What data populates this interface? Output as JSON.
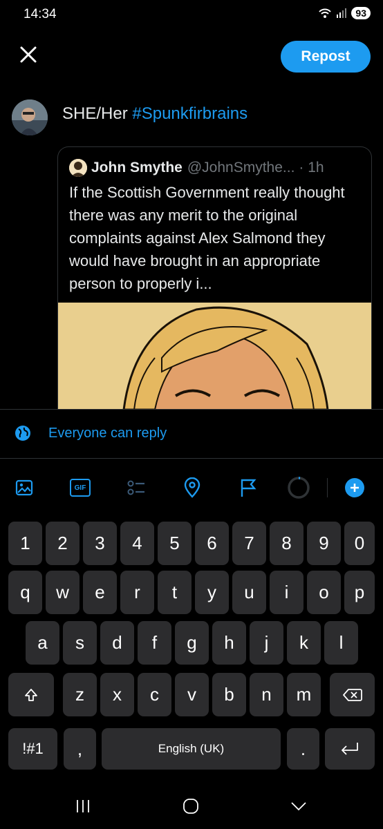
{
  "status_bar": {
    "time": "14:34",
    "battery": "93"
  },
  "header": {
    "close_icon": "close-icon",
    "repost_label": "Repost"
  },
  "compose": {
    "text_plain": "SHE/Her ",
    "hashtag": "#Spunkfirbrains"
  },
  "quote": {
    "name": "John Smythe",
    "handle": "@JohnSmythe...",
    "time": "· 1h",
    "body": "If the Scottish Government really thought there was any merit to the original complaints against Alex Salmond they would have brought in an appropriate person to properly i..."
  },
  "reply_setting": {
    "icon": "globe-icon",
    "label": "Everyone can reply"
  },
  "toolbar": {
    "items": [
      "image-icon",
      "gif-icon",
      "poll-icon",
      "location-icon",
      "flag-icon",
      "character-counter",
      "add-icon"
    ],
    "gif_label": "GIF"
  },
  "keyboard": {
    "numbers": [
      "1",
      "2",
      "3",
      "4",
      "5",
      "6",
      "7",
      "8",
      "9",
      "0"
    ],
    "row1": [
      "q",
      "w",
      "e",
      "r",
      "t",
      "y",
      "u",
      "i",
      "o",
      "p"
    ],
    "row2": [
      "a",
      "s",
      "d",
      "f",
      "g",
      "h",
      "j",
      "k",
      "l"
    ],
    "row3": [
      "z",
      "x",
      "c",
      "v",
      "b",
      "n",
      "m"
    ],
    "symbols_label": "!#1",
    "comma": ",",
    "space_label": "English (UK)",
    "period": "."
  },
  "colors": {
    "accent": "#1d9bf0",
    "background": "#000000",
    "key": "#2c2c2e"
  }
}
